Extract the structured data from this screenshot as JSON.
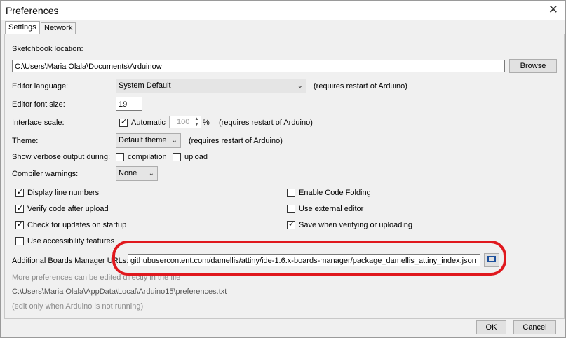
{
  "window": {
    "title": "Preferences",
    "close_glyph": "✕"
  },
  "tabs": [
    {
      "label": "Settings"
    },
    {
      "label": "Network"
    }
  ],
  "settings": {
    "sketchbook_label": "Sketchbook location:",
    "sketchbook_path": "C:\\Users\\Maria Olala\\Documents\\Arduinow",
    "browse_label": "Browse",
    "editor_language_label": "Editor language:",
    "editor_language_value": "System Default",
    "restart_note": "(requires restart of Arduino)",
    "font_size_label": "Editor font size:",
    "font_size_value": "19",
    "interface_scale_label": "Interface scale:",
    "automatic_label": "Automatic",
    "scale_value": "100",
    "percent_sign": "%",
    "theme_label": "Theme:",
    "theme_value": "Default theme",
    "verbose_label": "Show verbose output during:",
    "compilation_label": "compilation",
    "upload_label": "upload",
    "compiler_warnings_label": "Compiler warnings:",
    "compiler_warnings_value": "None",
    "checkboxes": [
      {
        "label": "Display line numbers",
        "checked": true
      },
      {
        "label": "Verify code after upload",
        "checked": true
      },
      {
        "label": "Check for updates on startup",
        "checked": true
      },
      {
        "label": "Use accessibility features",
        "checked": false
      },
      {
        "label": "Enable Code Folding",
        "checked": false
      },
      {
        "label": "Use external editor",
        "checked": false
      },
      {
        "label": "Save when verifying or uploading",
        "checked": true
      }
    ],
    "boards_urls_label": "Additional Boards Manager URLs:",
    "boards_urls_value": "githubusercontent.com/damellis/attiny/ide-1.6.x-boards-manager/package_damellis_attiny_index.json",
    "more_prefs_note": "More preferences can be edited directly in the file",
    "prefs_path": "C:\\Users\\Maria Olala\\AppData\\Local\\Arduino15\\preferences.txt",
    "edit_note": "(edit only when Arduino is not running)"
  },
  "footer": {
    "ok_label": "OK",
    "cancel_label": "Cancel"
  },
  "colors": {
    "annotation": "#e0181e"
  }
}
